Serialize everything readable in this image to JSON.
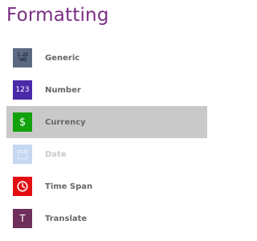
{
  "panel": {
    "title": "Formatting"
  },
  "items": [
    {
      "label": "Generic",
      "icon": "generic-format-icon",
      "icon_text_top": "1.23",
      "icon_text_bottom": "%03",
      "color": "#5b6a82",
      "state": "normal"
    },
    {
      "label": "Number",
      "icon": "number-format-icon",
      "icon_text": "123",
      "color": "#4a2aa8",
      "state": "normal"
    },
    {
      "label": "Currency",
      "icon": "currency-format-icon",
      "icon_text": "$",
      "color": "#13a10e",
      "state": "selected"
    },
    {
      "label": "Date",
      "icon": "calendar-icon",
      "color": "#c6d7f2",
      "state": "disabled"
    },
    {
      "label": "Time Span",
      "icon": "clock-icon",
      "color": "#e30e12",
      "state": "normal"
    },
    {
      "label": "Translate",
      "icon": "translate-icon",
      "icon_text": "T",
      "color": "#6e2f5a",
      "state": "normal"
    }
  ],
  "colors": {
    "title": "#7b2c84",
    "selected_background": "#c9c9c9",
    "label": "#666666",
    "disabled_label": "#c9c9c9"
  }
}
